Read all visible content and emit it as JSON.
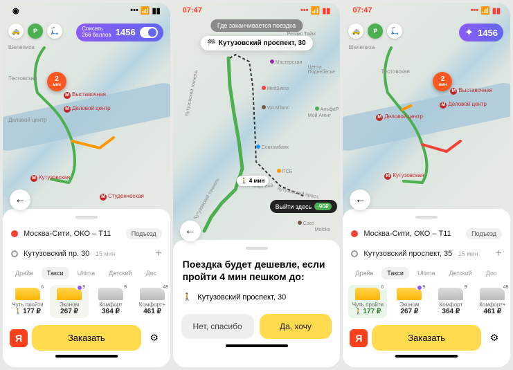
{
  "status": {
    "time": "07:47"
  },
  "loyalty": {
    "points": "1456",
    "action": "Списать",
    "sub": "266 баллов"
  },
  "eta": {
    "value": "2",
    "unit": "мин"
  },
  "screen1": {
    "from": "Москва-Сити, ОКО – Т11",
    "to": "Кутузовский пр. 30",
    "to_sub": "· 15 мин",
    "entrance": "Подъезд",
    "tabs": [
      "Драйв",
      "Такси",
      "Ultima",
      "Детский",
      "Дос"
    ],
    "tariffs": [
      {
        "name": "Чуть пройти",
        "price": "177 ₽",
        "badge": "6",
        "walk": true
      },
      {
        "name": "Эконом",
        "price": "267 ₽",
        "badge": "9",
        "purple": true,
        "sel": true
      },
      {
        "name": "Комфорт",
        "price": "364 ₽",
        "badge": "9",
        "gray": true
      },
      {
        "name": "Комфорт+",
        "price": "461 ₽",
        "badge": "48",
        "gray": true
      }
    ],
    "order": "Заказать",
    "map_labels": {
      "shelepikha": "Шелепиха",
      "testovskaya": "Тестовская",
      "vystavochnaya": "Выставочная",
      "delovoy": "Деловой центр",
      "kutuzovskaya": "Кутузовская",
      "studencheskaya": "Студенческая"
    }
  },
  "screen2": {
    "prompt": "Где заканчивается поездка",
    "dest_main": "Кутузовский проспект, 30",
    "walk_time": "4 мин",
    "exit_label": "Выйти здесь",
    "exit_save": "-90₽",
    "title_l1": "Поездка будет дешевле, если",
    "title_l2": "пройти 4 мин пешком до:",
    "dest_line": "Кутузовский проспект, 30",
    "btn_no": "Нет, спасибо",
    "btn_yes": "Да, хочу",
    "pois": {
      "relax": "Релакс Тайм",
      "masterskaya": "Мастерская",
      "podnebese": "Цента Поднебесье",
      "medswiss": "MedSwiss",
      "viamilano": "Via Milano",
      "alfa": "АльфаР",
      "moyagent": "Мой Агент",
      "sovcom": "Совкомбанк",
      "psb": "ПСБ",
      "kofeboy": "КофеБой",
      "coco": "Coco",
      "moloko": "Moloko",
      "tunnel": "Кутузовский тоннель",
      "prospekt": "Кутузовский просп."
    }
  },
  "screen3": {
    "from": "Москва-Сити, ОКО – Т11",
    "to": "Кутузовский проспект, 35",
    "to_sub": "· 15 мин",
    "entrance": "Подъезд",
    "tariffs": [
      {
        "name": "Чуть пройти",
        "price": "177 ₽",
        "badge": "6",
        "walk": true,
        "sel": true,
        "green": true
      },
      {
        "name": "Эконом",
        "price": "267 ₽",
        "badge": "9",
        "purple": true
      },
      {
        "name": "Комфорт",
        "price": "364 ₽",
        "badge": "9",
        "gray": true
      },
      {
        "name": "Комфорт+",
        "price": "461 ₽",
        "badge": "48",
        "gray": true
      }
    ]
  }
}
